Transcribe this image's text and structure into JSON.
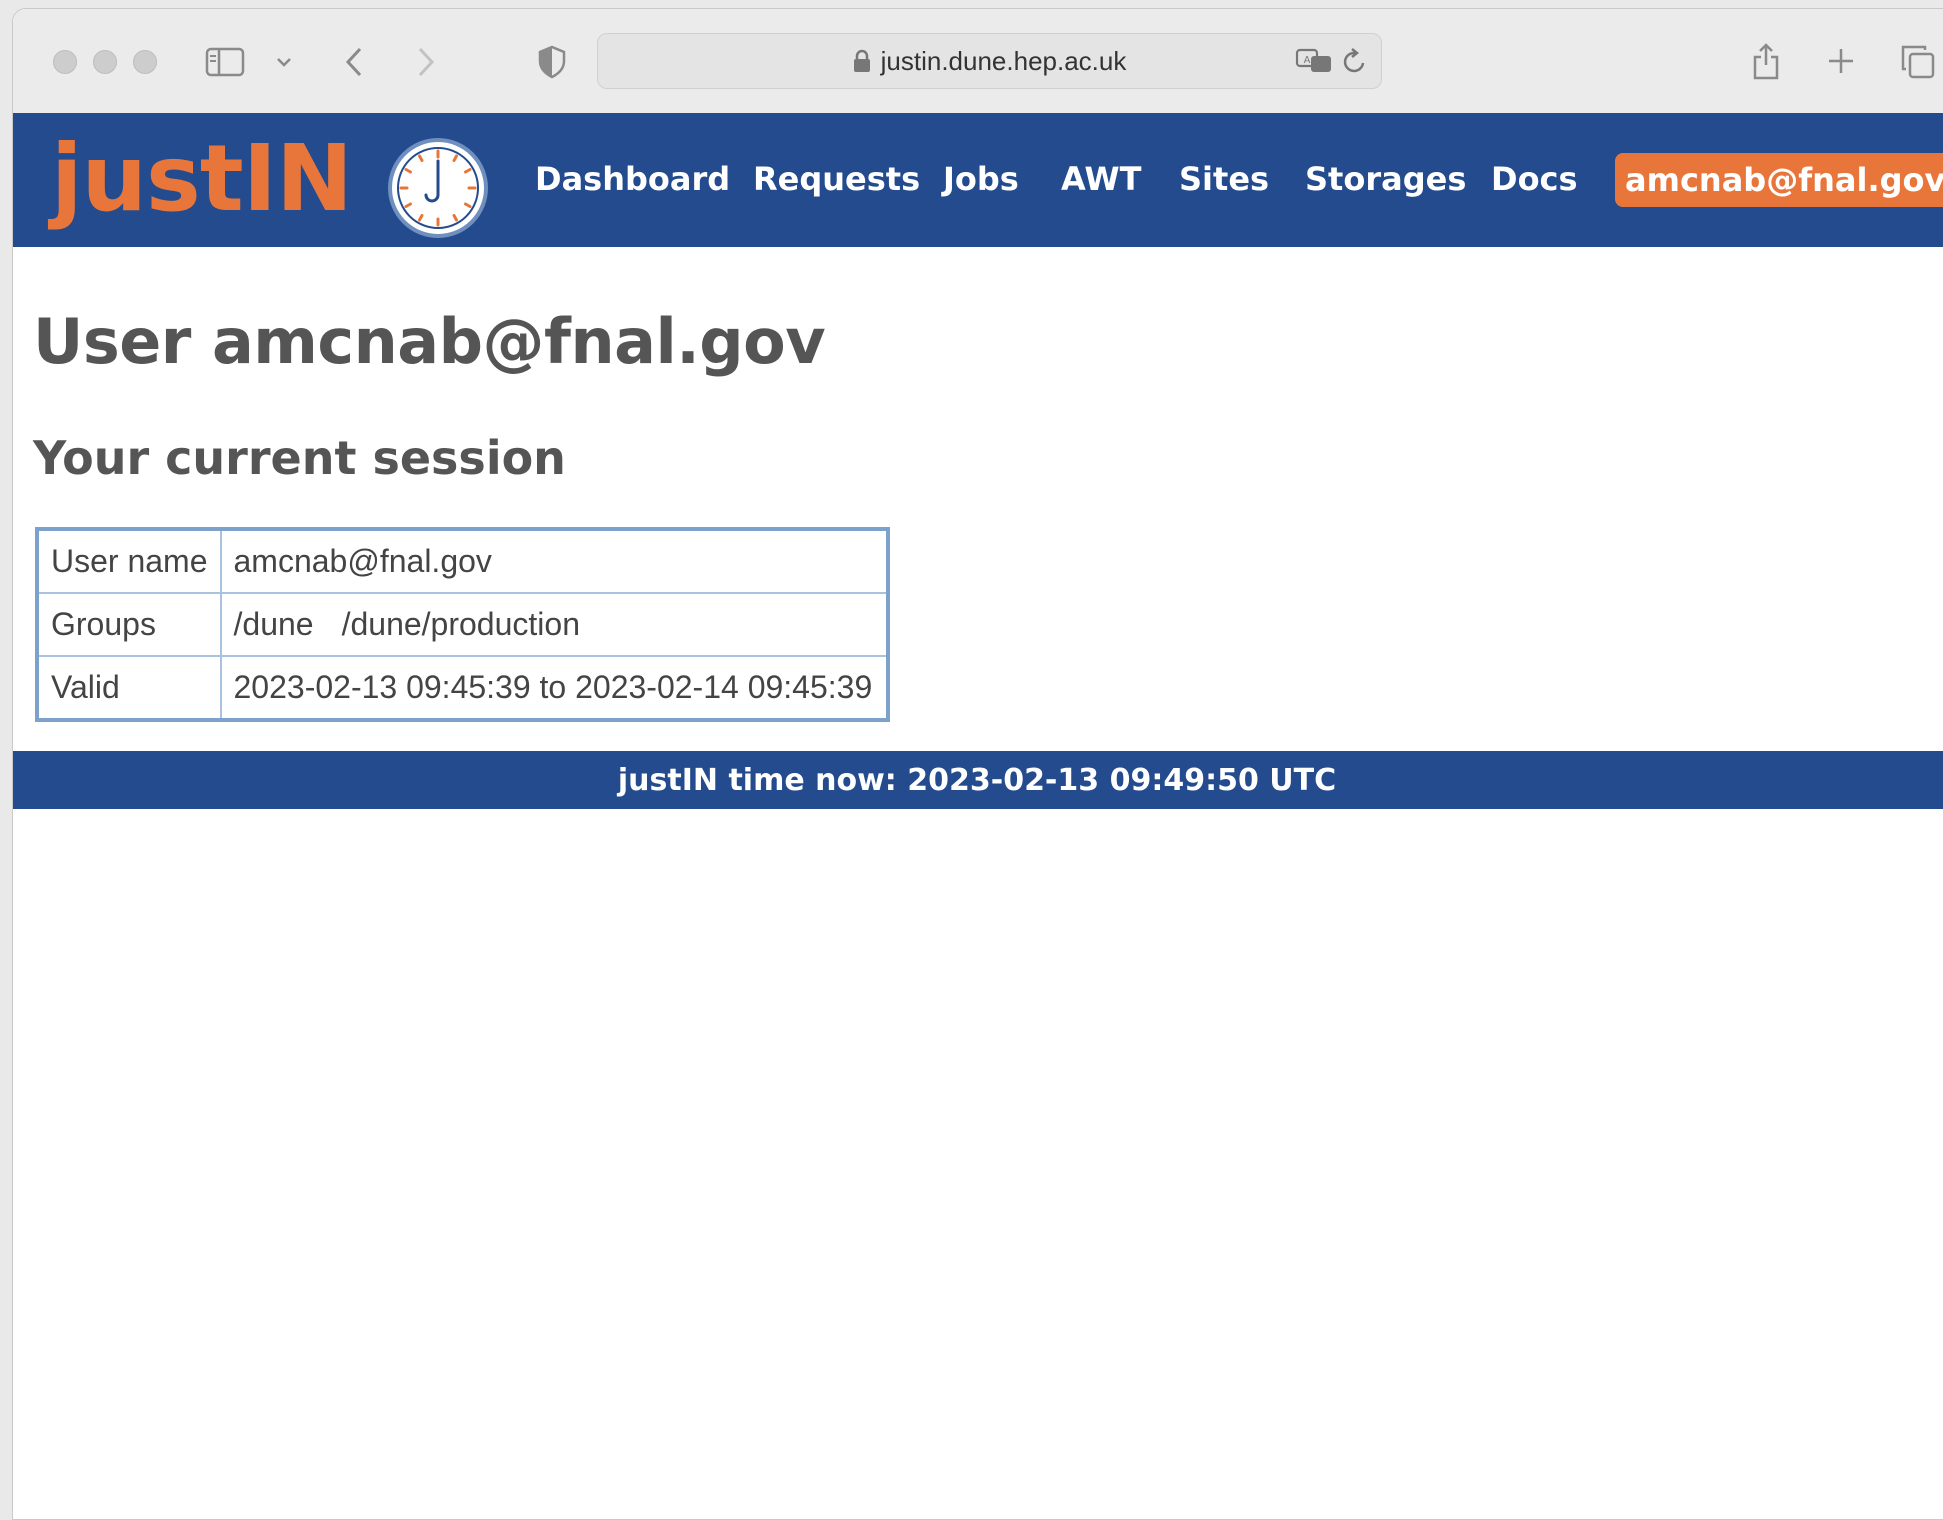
{
  "browser": {
    "url": "justin.dune.hep.ac.uk"
  },
  "nav": {
    "logo_text": "justIN",
    "links": [
      "Dashboard",
      "Requests",
      "Jobs",
      "AWT",
      "Sites",
      "Storages",
      "Docs"
    ],
    "user": "amcnab@fnal.gov"
  },
  "page": {
    "title": "User amcnab@fnal.gov",
    "section_title": "Your current session"
  },
  "session": {
    "rows": [
      {
        "key": "User name",
        "value": "amcnab@fnal.gov"
      },
      {
        "key": "Groups",
        "groups": [
          "/dune",
          "/dune/production"
        ]
      },
      {
        "key": "Valid",
        "value": "2023-02-13 09:45:39 to 2023-02-14 09:45:39"
      }
    ]
  },
  "footer": {
    "text": "justIN time now: 2023-02-13 09:49:50 UTC"
  },
  "colors": {
    "nav_bg": "#234b8e",
    "accent": "#e8763a",
    "table_border": "#7ca2cc"
  },
  "icons": [
    "sidebar-toggle-icon",
    "chevron-down-icon",
    "back-icon",
    "forward-icon",
    "shield-icon",
    "lock-icon",
    "translate-icon",
    "reload-icon",
    "share-icon",
    "new-tab-icon",
    "tabs-overview-icon",
    "clock-logo-icon"
  ]
}
